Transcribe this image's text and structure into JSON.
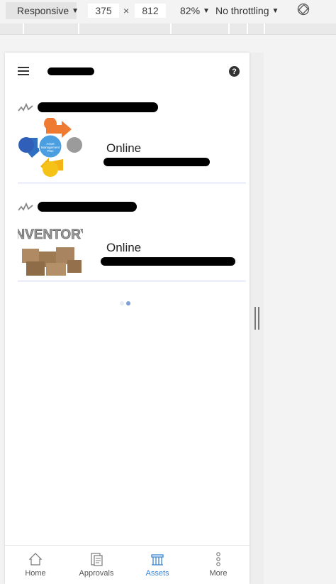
{
  "toolbar": {
    "device": "Responsive",
    "width": "375",
    "times": "×",
    "height": "812",
    "zoom": "82%",
    "throttle": "No throttling"
  },
  "help": {
    "glyph": "?"
  },
  "cards": [
    {
      "status": "Online",
      "thumb_title": "Asset Management Plan"
    },
    {
      "status": "Online",
      "thumb_title": "INVENTORY"
    }
  ],
  "tabs": [
    {
      "label": "Home"
    },
    {
      "label": "Approvals"
    },
    {
      "label": "Assets"
    },
    {
      "label": "More"
    }
  ],
  "colors": {
    "accent": "#3a86d6",
    "diagram_center": "#4b9fe0"
  }
}
